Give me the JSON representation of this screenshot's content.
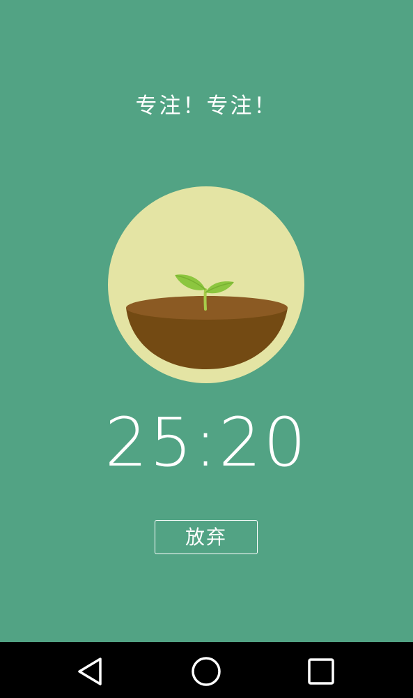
{
  "screen": {
    "headline": "专注！专注！",
    "timer": "25:20",
    "give_up_label": "放弃"
  },
  "colors": {
    "background": "#52a384",
    "circle": "#e4e4a4",
    "soil_top": "#8b5a23",
    "soil_bowl": "#734a13",
    "leaf": "#8cc63f",
    "stem": "#a7cc4a",
    "navbar": "#000000",
    "text": "#ffffff"
  },
  "navbar": {
    "back_icon": "triangle-back-icon",
    "home_icon": "circle-home-icon",
    "recent_icon": "square-recent-apps-icon"
  }
}
